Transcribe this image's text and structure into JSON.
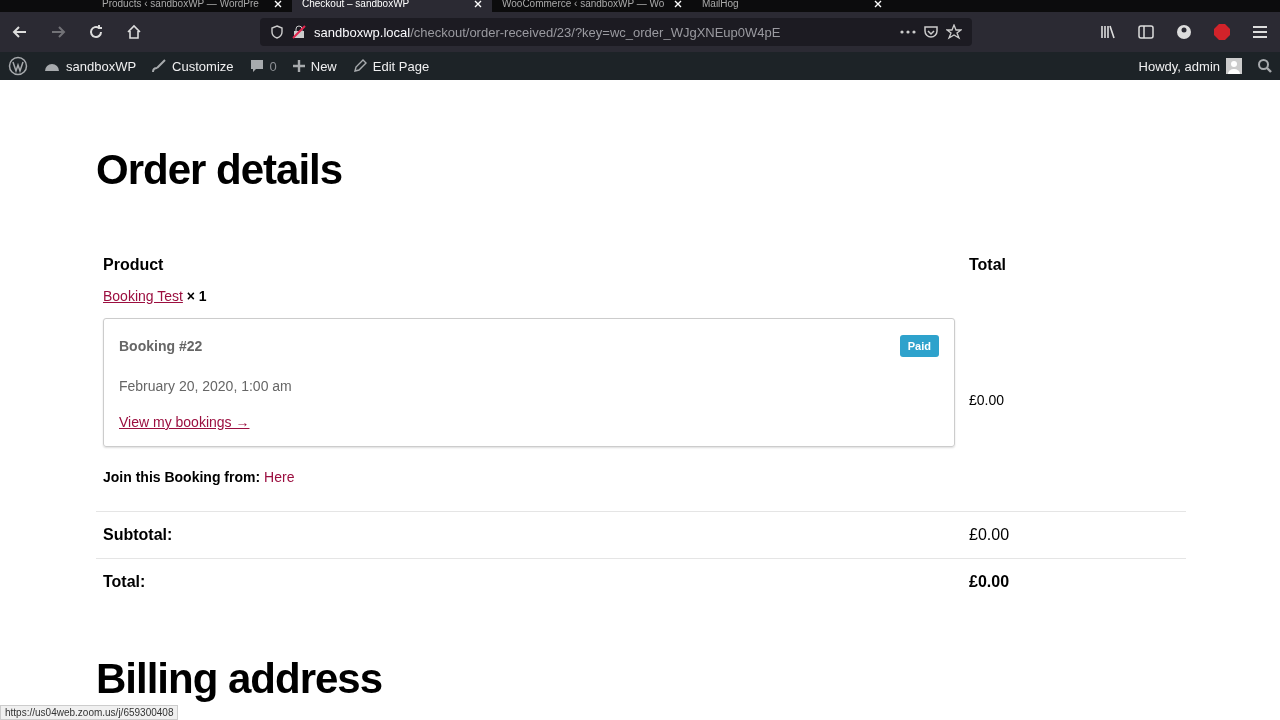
{
  "browser": {
    "tabs": [
      {
        "title": "Products ‹ sandboxWP — WordPre",
        "selected": false
      },
      {
        "title": "Checkout – sandboxWP",
        "selected": true
      },
      {
        "title": "WooCommerce ‹ sandboxWP — Wo",
        "selected": false
      },
      {
        "title": "MailHog",
        "selected": false
      }
    ],
    "url_host": "sandboxwp.local",
    "url_path": "/checkout/order-received/23/?key=wc_order_WJgXNEup0W4pE",
    "status_url": "https://us04web.zoom.us/j/659300408"
  },
  "admin_bar": {
    "site": "sandboxWP",
    "customize": "Customize",
    "comments": "0",
    "new": "New",
    "edit": "Edit Page",
    "greeting": "Howdy, admin"
  },
  "page": {
    "title": "Order details",
    "columns": [
      "Product",
      "Total"
    ],
    "item": {
      "product": "Booking Test",
      "quantity": "× 1",
      "total": "£0.00"
    },
    "booking": {
      "title": "Booking #22",
      "status": "Paid",
      "date": "February 20, 2020, 1:00 am",
      "link": "View my bookings →"
    },
    "join": {
      "label": "Join this Booking from:",
      "link": "Here"
    },
    "totals": [
      {
        "label": "Subtotal:",
        "value": "£0.00",
        "bold": false
      },
      {
        "label": "Total:",
        "value": "£0.00",
        "bold": true
      }
    ],
    "next_heading": "Billing address"
  }
}
